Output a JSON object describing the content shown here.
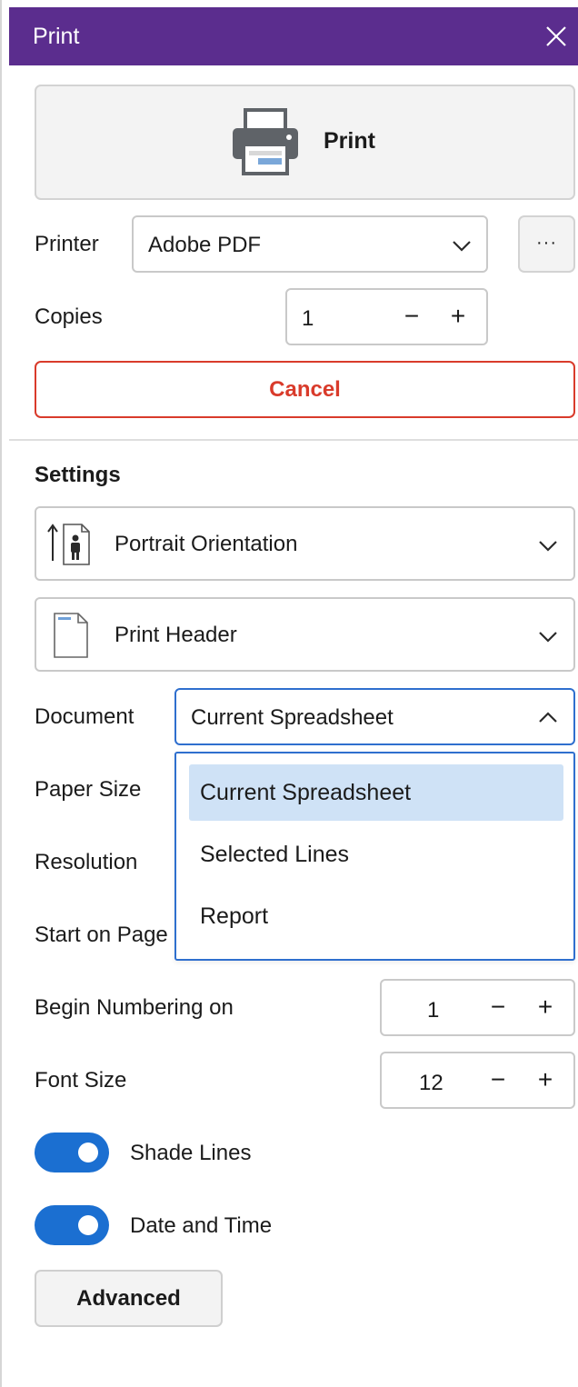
{
  "window": {
    "title": "Print"
  },
  "print_button": {
    "label": "Print"
  },
  "printer": {
    "label": "Printer",
    "value": "Adobe PDF",
    "more_label": "···"
  },
  "copies": {
    "label": "Copies",
    "value": "1",
    "minus": "−",
    "plus": "+"
  },
  "cancel_button": {
    "label": "Cancel"
  },
  "settings": {
    "heading": "Settings",
    "orientation": "Portrait Orientation",
    "header": "Print Header"
  },
  "document": {
    "label": "Document",
    "value": "Current Spreadsheet",
    "options": [
      "Current Spreadsheet",
      "Selected Lines",
      "Report"
    ]
  },
  "paper_size": {
    "label": "Paper Size"
  },
  "resolution": {
    "label": "Resolution"
  },
  "start_on_page": {
    "label": "Start on Page"
  },
  "begin_numbering": {
    "label": "Begin Numbering on",
    "value": "1",
    "minus": "−",
    "plus": "+"
  },
  "font_size": {
    "label": "Font Size",
    "value": "12",
    "minus": "−",
    "plus": "+"
  },
  "shade_lines": {
    "label": "Shade Lines",
    "on": true
  },
  "date_time": {
    "label": "Date and Time",
    "on": true
  },
  "advanced_button": {
    "label": "Advanced"
  },
  "colors": {
    "title_bar": "#5b2d8e",
    "accent": "#1b6fd1",
    "cancel": "#d93b2b",
    "selected_option": "#cfe2f6"
  }
}
